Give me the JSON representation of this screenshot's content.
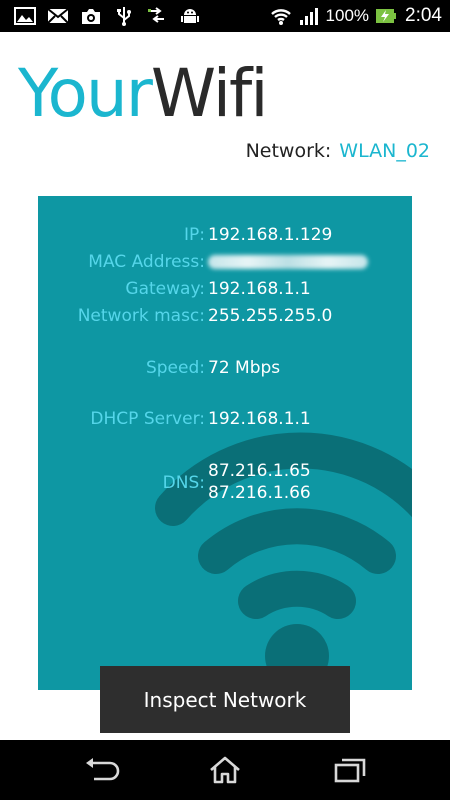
{
  "status_bar": {
    "battery_percent": "100%",
    "time": "2:04",
    "left_icons": [
      "gallery-icon",
      "mail-icon",
      "camera-icon",
      "usb-icon",
      "data-transfer-icon",
      "android-icon"
    ],
    "right_icons": [
      "wifi-icon",
      "signal-icon",
      "battery-charging-icon"
    ]
  },
  "header": {
    "title_part1": "Your",
    "title_part2": "Wifi",
    "network_label": "Network:",
    "network_value": "WLAN_02"
  },
  "info": {
    "ip_label": "IP:",
    "ip_value": "192.168.1.129",
    "mac_label": "MAC Address:",
    "gateway_label": "Gateway:",
    "gateway_value": "192.168.1.1",
    "mask_label": "Network masc:",
    "mask_value": "255.255.255.0",
    "speed_label": "Speed:",
    "speed_value": "72 Mbps",
    "dhcp_label": "DHCP Server:",
    "dhcp_value": "192.168.1.1",
    "dns_label": "DNS:",
    "dns_value_1": "87.216.1.65",
    "dns_value_2": "87.216.1.66"
  },
  "toast": {
    "label": "Inspect Network"
  },
  "nav_bar": {
    "buttons": [
      "back-icon",
      "home-icon",
      "recent-apps-icon"
    ]
  },
  "colors": {
    "accent": "#1bb6cf",
    "panel": "#0e97a3",
    "label": "#55d6ea",
    "wifi_art": "#0a6f77"
  }
}
